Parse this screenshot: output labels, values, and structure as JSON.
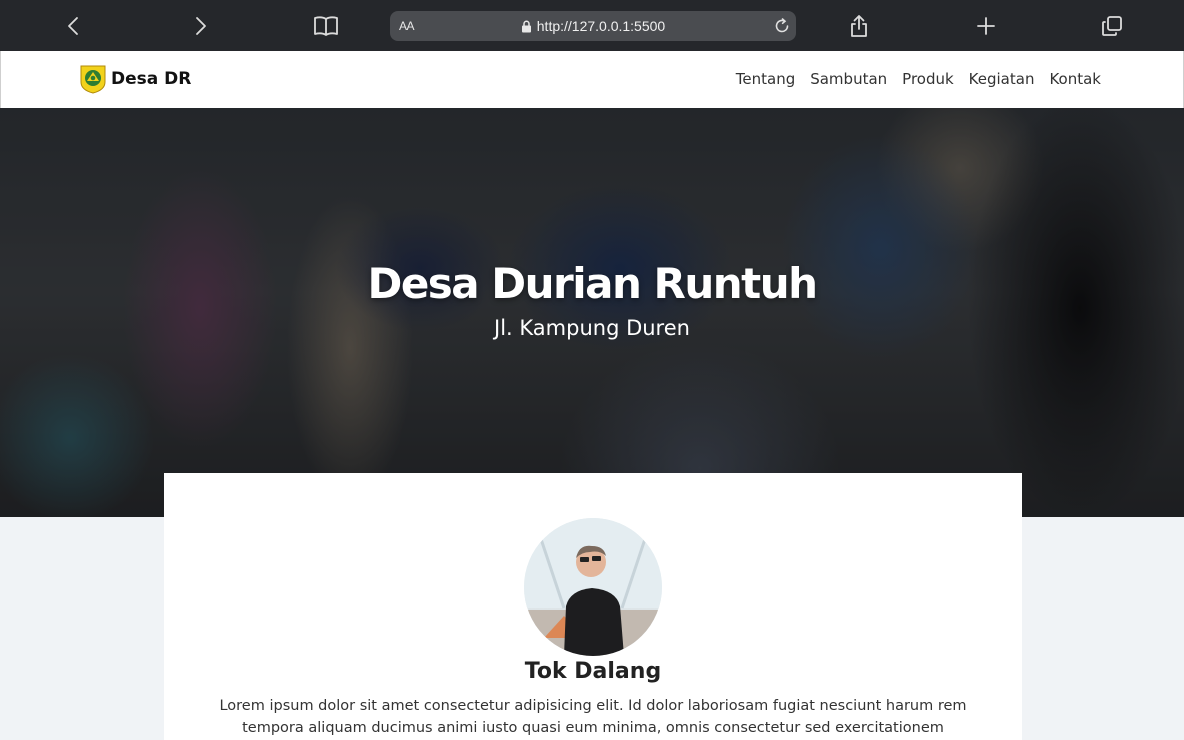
{
  "browser": {
    "aa_label": "AA",
    "url": "http://127.0.0.1:5500",
    "icons": [
      "back-icon",
      "forward-icon",
      "bookmarks-icon",
      "lock-icon",
      "reload-icon",
      "share-icon",
      "new-tab-icon",
      "tabs-icon"
    ]
  },
  "navbar": {
    "brand": "Desa DR",
    "links": [
      "Tentang",
      "Sambutan",
      "Produk",
      "Kegiatan",
      "Kontak"
    ]
  },
  "hero": {
    "title": "Desa Durian Runtuh",
    "subtitle": "Jl. Kampung Duren"
  },
  "profile": {
    "name": "Tok Dalang",
    "bio": "Lorem ipsum dolor sit amet consectetur adipisicing elit. Id dolor laboriosam fugiat nesciunt harum rem tempora aliquam ducimus animi iusto quasi eum minima, omnis consectetur sed exercitationem"
  },
  "colors": {
    "browser_bar": "#25272b",
    "address_bar": "#4a4c50",
    "page_background": "#f0f3f6",
    "card": "#ffffff",
    "logo_yellow": "#f2d21b",
    "logo_green": "#2e7d32"
  }
}
